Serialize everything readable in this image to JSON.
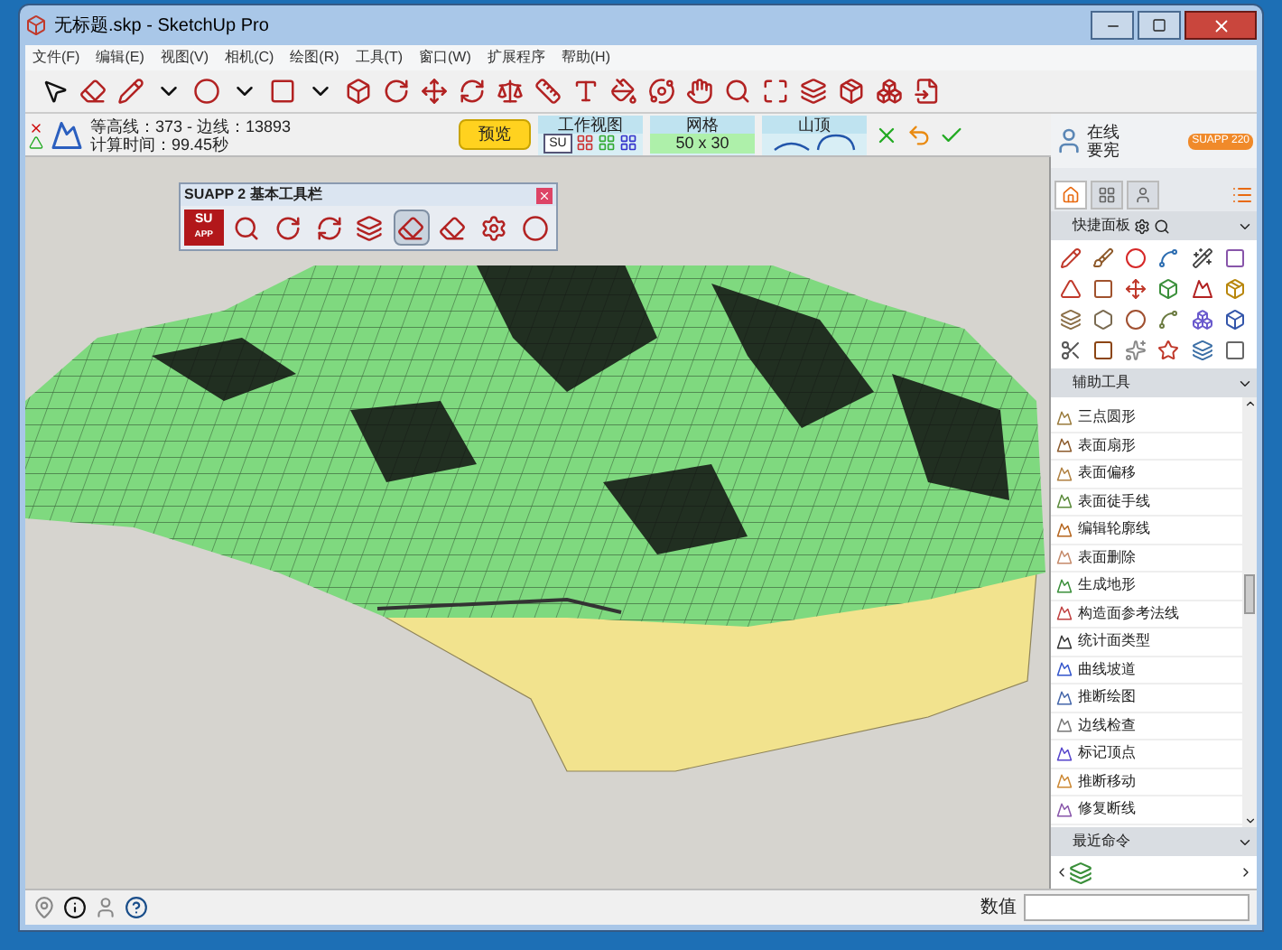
{
  "window": {
    "title": "无标题.skp - SketchUp Pro"
  },
  "menu": [
    "文件(F)",
    "编辑(E)",
    "视图(V)",
    "相机(C)",
    "绘图(R)",
    "工具(T)",
    "窗口(W)",
    "扩展程序",
    "帮助(H)"
  ],
  "plugin_bar": {
    "stats_line1": "等高线：373 - 边线：13893",
    "stats_line2": "计算时间：99.45秒",
    "preview_button": "预览",
    "groups": [
      {
        "title": "工作视图",
        "kind": "views",
        "label": "SU"
      },
      {
        "title": "网格",
        "kind": "value",
        "value": "50 x 30"
      },
      {
        "title": "山顶",
        "kind": "curves"
      }
    ]
  },
  "account": {
    "status": "在线",
    "name": "要宪",
    "badge": "SUAPP 220"
  },
  "floating_toolbar": {
    "title": "SUAPP 2 基本工具栏",
    "logo": "SU",
    "logo_sub": "APP",
    "tools": [
      {
        "selected": false
      },
      {
        "selected": false
      },
      {
        "selected": false
      },
      {
        "selected": false
      },
      {
        "selected": true
      },
      {
        "selected": false
      },
      {
        "selected": false
      },
      {
        "selected": false
      }
    ]
  },
  "panel_tabs": [
    {
      "selected": true
    },
    {
      "selected": false
    },
    {
      "selected": false
    }
  ],
  "quick_panel": {
    "title": "快捷面板"
  },
  "aux_tools": {
    "title": "辅助工具",
    "items": [
      "三点圆形",
      "表面扇形",
      "表面偏移",
      "表面徒手线",
      "编辑轮廓线",
      "表面删除",
      "生成地形",
      "构造面参考法线",
      "统计面类型",
      "曲线坡道",
      "推断绘图",
      "边线检查",
      "标记顶点",
      "推断移动",
      "修复断线"
    ]
  },
  "recent": {
    "title": "最近命令"
  },
  "status_bar": {
    "value_label": "数值"
  }
}
